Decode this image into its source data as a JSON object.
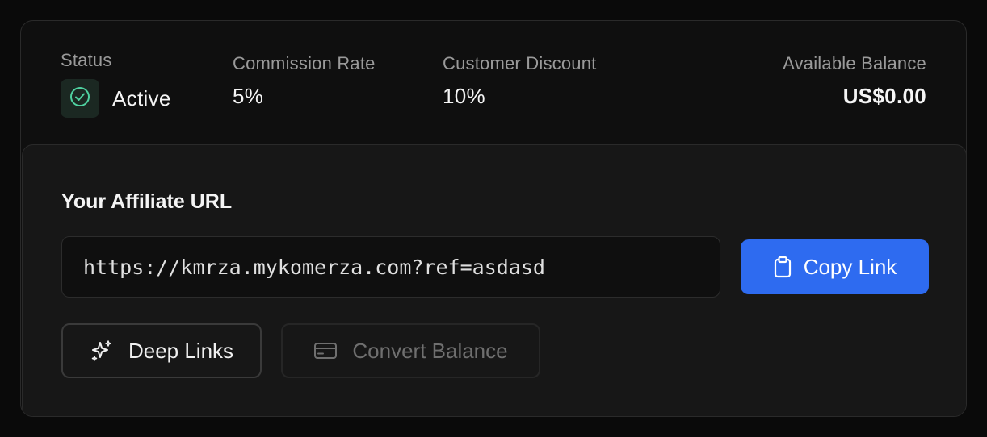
{
  "stats": {
    "status": {
      "label": "Status",
      "value": "Active",
      "icon": "check-circle-icon"
    },
    "commission": {
      "label": "Commission Rate",
      "value": "5%"
    },
    "discount": {
      "label": "Customer Discount",
      "value": "10%"
    },
    "balance": {
      "label": "Available Balance",
      "value": "US$0.00"
    }
  },
  "affiliate": {
    "title": "Your Affiliate URL",
    "url": "https://kmrza.mykomerza.com?ref=asdasd",
    "copy_label": "Copy Link",
    "copy_icon": "clipboard-icon"
  },
  "actions": {
    "deep_links_label": "Deep Links",
    "deep_links_icon": "sparkles-icon",
    "convert_label": "Convert Balance",
    "convert_icon": "credit-card-icon",
    "convert_disabled": true
  },
  "colors": {
    "accent": "#2e6bf0",
    "success": "#4fd1a0",
    "background": "#0a0a0a",
    "panel": "#171717"
  }
}
